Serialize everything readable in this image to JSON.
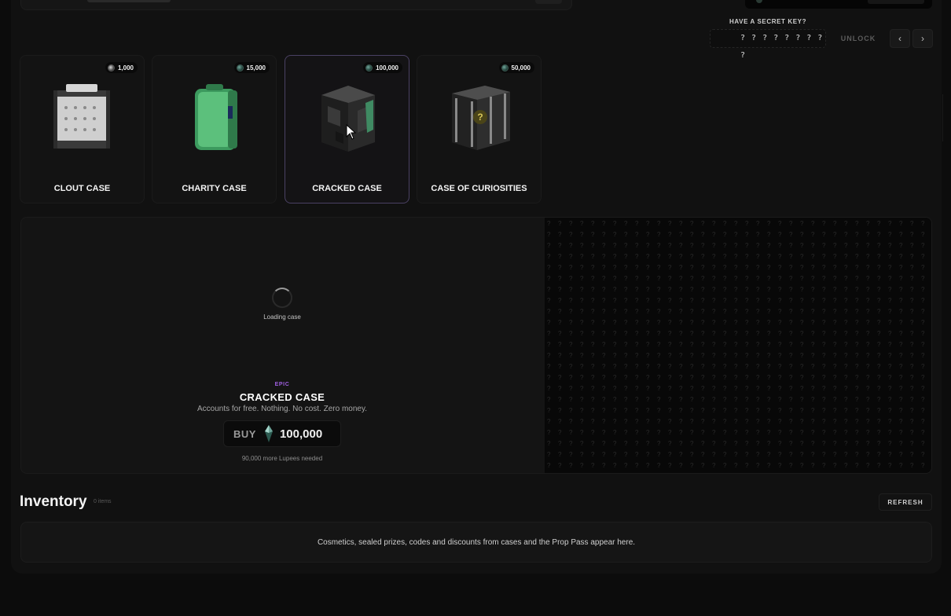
{
  "secret_key": {
    "label": "HAVE A SECRET KEY?",
    "placeholder": "? ? ? ? ? ? ? ? ?",
    "unlock_label": "UNLOCK",
    "prev_label": "‹",
    "next_label": "›"
  },
  "cases": [
    {
      "name": "CLOUT CASE",
      "price": "1,000"
    },
    {
      "name": "CHARITY CASE",
      "price": "15,000"
    },
    {
      "name": "CRACKED CASE",
      "price": "100,000"
    },
    {
      "name": "CASE OF CURIOSITIES",
      "price": "50,000"
    }
  ],
  "selected_case": {
    "loading_text": "Loading case",
    "rarity": "EPIC",
    "title": "CRACKED CASE",
    "description": "Accounts for free. Nothing. No cost. Zero money.",
    "buy_label": "BUY",
    "price": "100,000",
    "needed_text": "90,000 more Lupees needed"
  },
  "inventory": {
    "title": "Inventory",
    "count": "0 items",
    "refresh_label": "REFRESH",
    "empty_text": "Cosmetics, sealed prizes, codes and discounts from cases and the Prop Pass appear here."
  },
  "colors": {
    "accent_epic": "#9f5fe0",
    "selected_border": "#4a4163",
    "currency_gem": "#6fa59a"
  }
}
